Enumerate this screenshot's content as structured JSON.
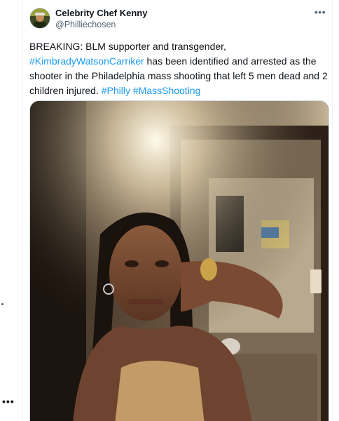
{
  "tweet": {
    "author_name": "Celebrity Chef Kenny",
    "author_handle": "@Philliechosen",
    "more_icon": "more-horizontal-icon",
    "body": {
      "line1": "BREAKING: BLM supporter and transgender,",
      "hashtag1": "#KimbradyWatsonCarriker",
      "text2": " has been identified and arrested as the shooter in the Philadelphia mass shooting that left 5 men dead and 2 children injured. ",
      "hashtag2": "#Philly",
      "hashtag3": "#MassShooting"
    },
    "media_alt": "Selfie photo of a person with braids in front of a mirror"
  },
  "side_rail": {
    "more_label": "•••"
  },
  "colors": {
    "link": "#1d9bf0",
    "text": "#0f1419",
    "muted": "#536471",
    "border": "#cfd9de"
  }
}
